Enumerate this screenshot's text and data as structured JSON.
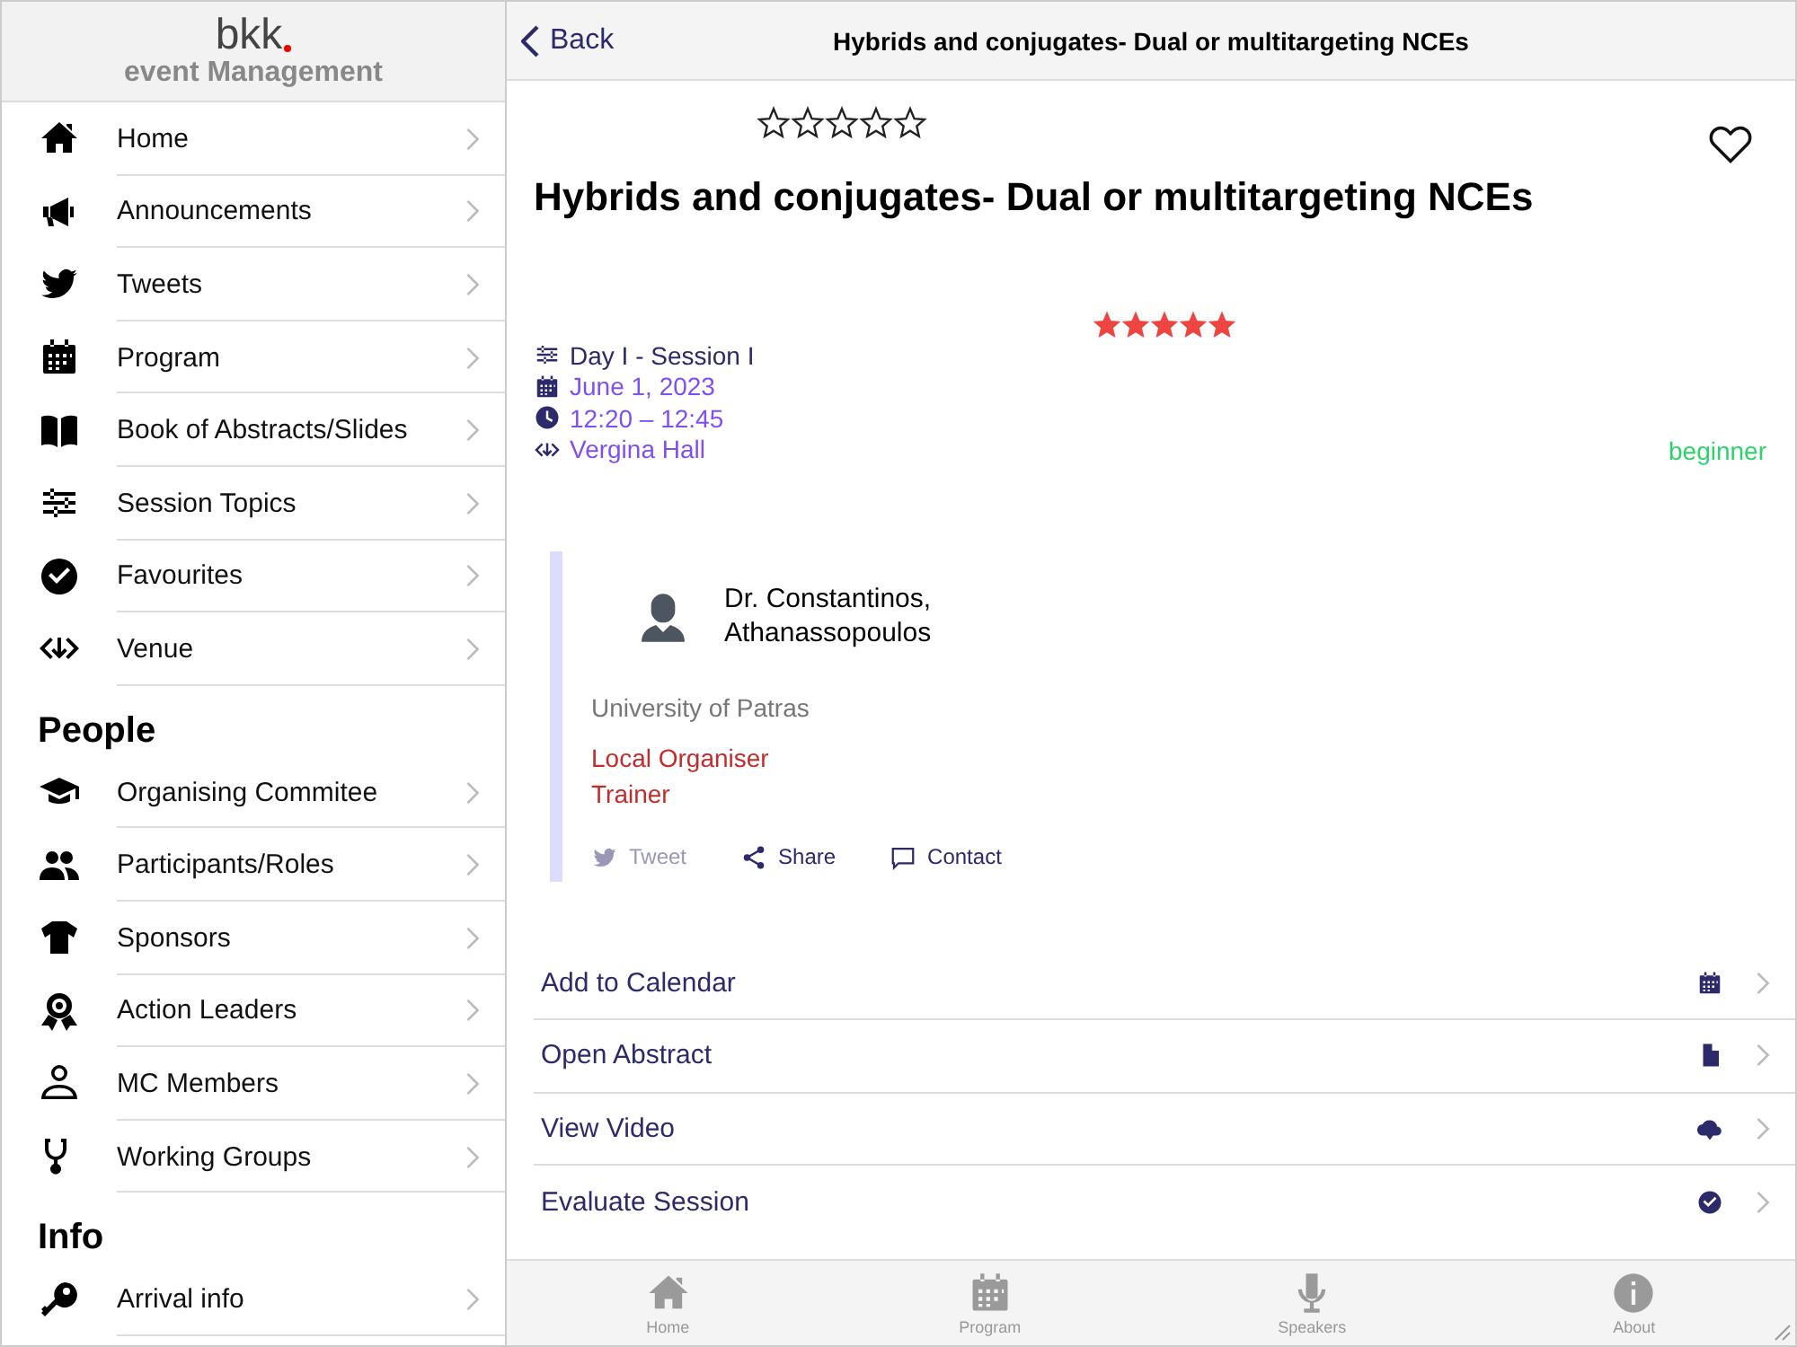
{
  "sidebar": {
    "logo": {
      "name": "bkk",
      "subtitle": "event Management"
    },
    "sections": [
      {
        "items": [
          {
            "label": "Home"
          },
          {
            "label": "Announcements"
          },
          {
            "label": "Tweets"
          },
          {
            "label": "Program"
          },
          {
            "label": "Book of Abstracts/Slides"
          },
          {
            "label": "Session Topics"
          },
          {
            "label": "Favourites"
          },
          {
            "label": "Venue"
          }
        ]
      },
      {
        "heading": "People",
        "items": [
          {
            "label": "Organising Commitee"
          },
          {
            "label": "Participants/Roles"
          },
          {
            "label": "Sponsors"
          },
          {
            "label": "Action Leaders"
          },
          {
            "label": "MC Members"
          },
          {
            "label": "Working Groups"
          }
        ]
      },
      {
        "heading": "Info",
        "items": [
          {
            "label": "Arrival info"
          }
        ]
      }
    ]
  },
  "nav_bar": {
    "back": "Back",
    "title": "Hybrids and conjugates- Dual or multitargeting NCEs"
  },
  "session": {
    "rating": {
      "stars": 0
    },
    "favourite": false,
    "title": "Hybrids and conjugates- Dual or multitargeting NCEs",
    "score": {
      "stars": 5
    },
    "details": [
      {
        "kind": "session",
        "text": "Day I - Session I"
      },
      {
        "kind": "date",
        "text": "June 1, 2023"
      },
      {
        "kind": "time",
        "text": "12:20 – 12:45"
      },
      {
        "kind": "venue",
        "text": "Vergina Hall"
      }
    ],
    "level": "beginner"
  },
  "speaker": {
    "name": "Dr. Constantinos, Athanassopoulos",
    "affiliation": "University of Patras",
    "roles": [
      "Local Organiser",
      "Trainer"
    ],
    "actions": [
      {
        "kind": "tweet",
        "label": "Tweet",
        "disabled": true
      },
      {
        "kind": "share",
        "label": "Share",
        "disabled": false
      },
      {
        "kind": "contact",
        "label": "Contact",
        "disabled": false
      }
    ]
  },
  "actions": [
    {
      "kind": "calendar",
      "label": "Add to Calendar"
    },
    {
      "kind": "document",
      "label": "Open Abstract"
    },
    {
      "kind": "video",
      "label": "View Video"
    },
    {
      "kind": "evaluate",
      "label": "Evaluate Session"
    }
  ],
  "tab_bar": [
    {
      "kind": "home",
      "label": "Home"
    },
    {
      "kind": "program",
      "label": "Program"
    },
    {
      "kind": "speakers",
      "label": "Speakers"
    },
    {
      "kind": "about",
      "label": "About"
    }
  ]
}
